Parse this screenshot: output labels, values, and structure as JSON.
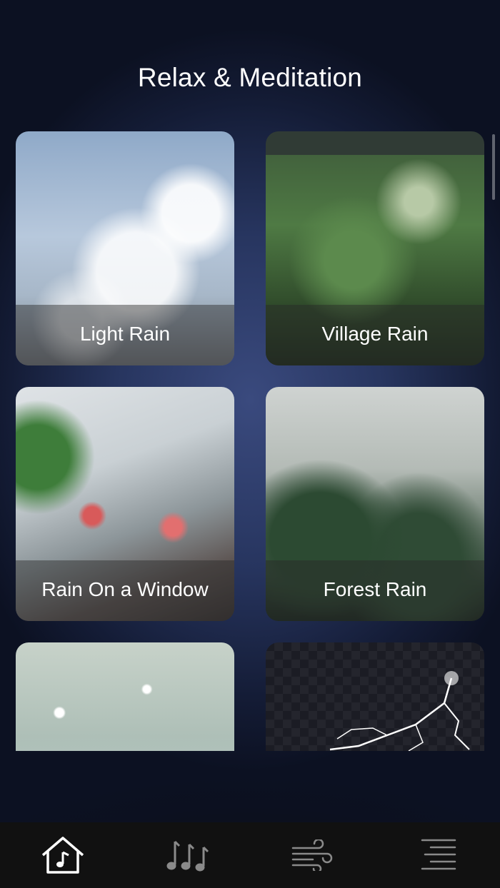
{
  "header": {
    "title": "Relax & Meditation"
  },
  "sounds": [
    {
      "label": "Light Rain"
    },
    {
      "label": "Village Rain"
    },
    {
      "label": "Rain On a Window"
    },
    {
      "label": "Forest Rain"
    },
    {
      "label": ""
    },
    {
      "label": ""
    }
  ],
  "tabbar": {
    "items": [
      {
        "icon": "home-music-icon",
        "active": true
      },
      {
        "icon": "music-notes-icon",
        "active": false
      },
      {
        "icon": "wind-icon",
        "active": false
      },
      {
        "icon": "menu-lines-icon",
        "active": false
      }
    ]
  },
  "colors": {
    "active_icon": "#ffffff",
    "inactive_icon": "#8a8a8a",
    "tabbar_bg": "#111111"
  }
}
